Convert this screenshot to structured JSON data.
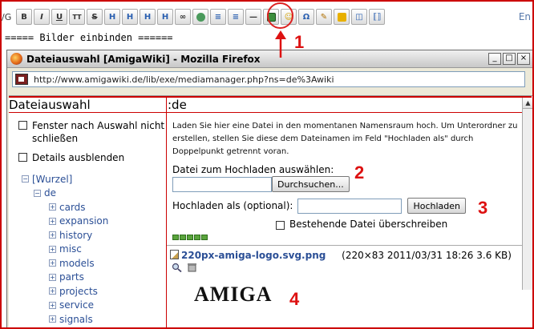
{
  "toolbar": {
    "prefix": "/G",
    "buttons": [
      {
        "name": "bold-button",
        "label": "B"
      },
      {
        "name": "italic-button",
        "label": "I"
      },
      {
        "name": "underline-button",
        "label": "U"
      },
      {
        "name": "code-button",
        "label": "TT"
      },
      {
        "name": "strike-button",
        "label": "S"
      },
      {
        "name": "heading-same-button",
        "label": "H"
      },
      {
        "name": "heading-lower-button",
        "label": "H"
      },
      {
        "name": "heading-higher-button",
        "label": "H"
      },
      {
        "name": "heading-menu-button",
        "label": "H"
      },
      {
        "name": "link-button",
        "label": "∞"
      },
      {
        "name": "external-link-button",
        "label": ""
      },
      {
        "name": "ordered-list-button",
        "label": "≡"
      },
      {
        "name": "unordered-list-button",
        "label": "≡"
      },
      {
        "name": "horizontal-rule-button",
        "label": "—"
      },
      {
        "name": "add-image-button",
        "label": ""
      },
      {
        "name": "smiley-button",
        "label": "☺"
      },
      {
        "name": "special-chars-button",
        "label": "Ω"
      },
      {
        "name": "signature-button",
        "label": "✎"
      },
      {
        "name": "plugin-button-1",
        "label": ""
      },
      {
        "name": "plugin-button-2",
        "label": "◫"
      },
      {
        "name": "plugin-button-3",
        "label": "⟦⟧"
      }
    ],
    "right_text": "En"
  },
  "editor": {
    "line": "===== Bilder einbinden ======"
  },
  "callouts": [
    "1",
    "2",
    "3",
    "4"
  ],
  "window": {
    "title": "Dateiauswahl [AmigaWiki] - Mozilla Firefox",
    "url": "http://www.amigawiki.de/lib/exe/mediamanager.php?ns=de%3Awiki",
    "controls": [
      "_",
      "□",
      "×"
    ]
  },
  "left": {
    "title": "Dateiauswahl",
    "options": [
      "Fenster nach Auswahl nicht schließen",
      "Details ausblenden"
    ],
    "tree": {
      "root": "[Wurzel]",
      "child": "de",
      "items": [
        "cards",
        "expansion",
        "history",
        "misc",
        "models",
        "parts",
        "projects",
        "service",
        "signals"
      ]
    }
  },
  "right": {
    "namespace": ":de",
    "intro": "Laden Sie hier eine Datei in den momentanen Namensraum hoch. Um Unterordner zu erstellen, stellen Sie diese dem Dateinamen im Feld \"Hochladen als\" durch Doppelpunkt getrennt voran.",
    "upload_label": "Datei zum Hochladen auswählen:",
    "browse_button": "Durchsuchen...",
    "upload_as_label": "Hochladen als (optional):",
    "upload_button": "Hochladen",
    "overwrite_label": "Bestehende Datei überschreiben",
    "file": {
      "name": "220px-amiga-logo.svg.png",
      "meta": "(220×83 2011/03/31 18:26 3.6 KB)"
    },
    "logo_text": "AMIGA"
  }
}
